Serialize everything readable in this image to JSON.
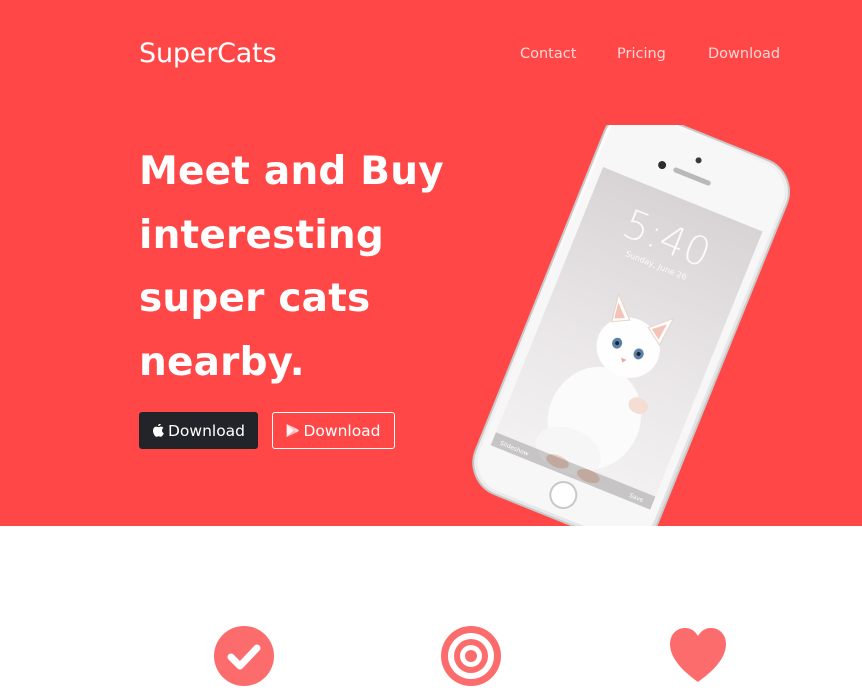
{
  "brand": {
    "name": "SuperCats"
  },
  "nav": {
    "items": [
      "Contact",
      "Pricing",
      "Download"
    ]
  },
  "hero": {
    "headline_lines": [
      "Meet and Buy",
      "interesting",
      "super cats",
      "nearby."
    ],
    "buttons": {
      "apple_label": "Download",
      "play_label": "Download"
    },
    "phone": {
      "time": "5:40",
      "date": "Sunday, June 26",
      "left_label": "Slideshow",
      "right_label": "Save"
    }
  },
  "features": {
    "icons": [
      "check-circle-icon",
      "target-icon",
      "heart-icon"
    ]
  },
  "colors": {
    "primary": "#ff4747",
    "icon": "#fd6c6c",
    "dark_button": "#212529",
    "nav_link": "#ffd6d6"
  }
}
